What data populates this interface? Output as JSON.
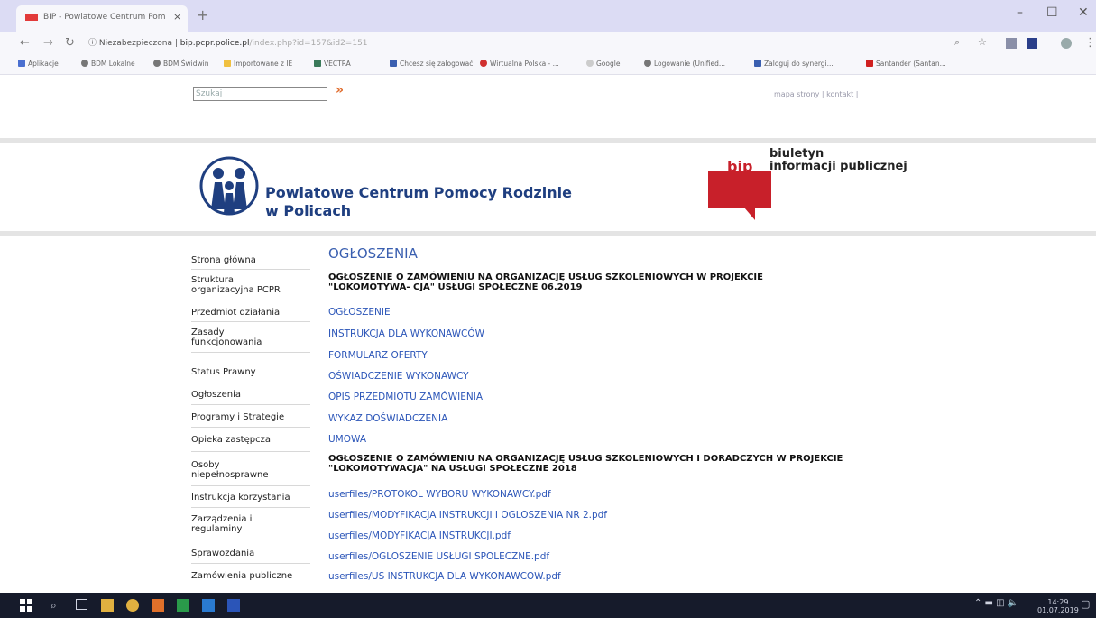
{
  "browser": {
    "tab_title": "BIP - Powiatowe Centrum Pomo",
    "tab_close": "×",
    "new_tab": "+",
    "url_security": "Niezabezpieczona",
    "url_host": "bip.pcpr.police.pl",
    "url_path": "/index.php?id=157&id2=151",
    "bookmarks": [
      "Aplikacje",
      "BDM Lokalne",
      "BDM Świdwin",
      "Importowane z IE",
      "VECTRA",
      "Chcesz się zalogować",
      "Wirtualna Polska - ...",
      "Google",
      "Logowanie (Unified...",
      "Zaloguj do synergi...",
      "Santander (Santan..."
    ]
  },
  "page": {
    "search_placeholder": "Szukaj",
    "search_go": "»",
    "top_links": "mapa strony  |  kontakt  |",
    "org_name_line1": "Powiatowe Centrum Pomocy Rodzinie",
    "org_name_line2": "w Policach",
    "bip_word": "bip",
    "bip_line1": "biuletyn",
    "bip_line2": "informacji publicznej"
  },
  "sidebar": {
    "items": [
      "Strona główna",
      "Struktura organizacyjna PCPR",
      "Przedmiot działania",
      "Zasady funkcjonowania",
      "Status Prawny",
      "Ogłoszenia",
      "Programy i Strategie",
      "Opieka zastępcza",
      "Osoby niepełnosprawne",
      "Instrukcja korzystania",
      "Zarządzenia i regulaminy",
      "Sprawozdania",
      "Zamówienia publiczne"
    ]
  },
  "content": {
    "title": "OGŁOSZENIA",
    "heading1": "OGŁOSZENIE O ZAMÓWIENIU NA ORGANIZACJĘ USŁUG SZKOLENIOWYCH W PROJEKCIE \"LOKOMOTYWA- CJA\" USŁUGI SPOŁECZNE 06.2019",
    "links1": [
      "OGŁOSZENIE",
      "INSTRUKCJA DLA WYKONAWCÓW",
      "FORMULARZ OFERTY",
      "OŚWIADCZENIE WYKONAWCY",
      "OPIS PRZEDMIOTU ZAMÓWIENIA",
      "WYKAZ DOŚWIADCZENIA",
      "UMOWA"
    ],
    "heading2": "OGŁOSZENIE O ZAMÓWIENIU NA ORGANIZACJĘ USŁUG SZKOLENIOWYCH I DORADCZYCH W PROJEKCIE \"LOKOMOTYWACJA\" NA USŁUGI SPOŁECZNE 2018",
    "links2": [
      "userfiles/PROTOKOL WYBORU WYKONAWCY.pdf",
      "userfiles/MODYFIKACJA INSTRUKCJI I OGLOSZENIA NR 2.pdf",
      "userfiles/MODYFIKACJA INSTRUKCJI.pdf",
      "userfiles/OGLOSZENIE USŁUGI SPOLECZNE.pdf",
      "userfiles/US INSTRUKCJA DLA WYKONAWCOW.pdf"
    ]
  },
  "taskbar": {
    "time": "14:29",
    "date": "01.07.2019"
  }
}
